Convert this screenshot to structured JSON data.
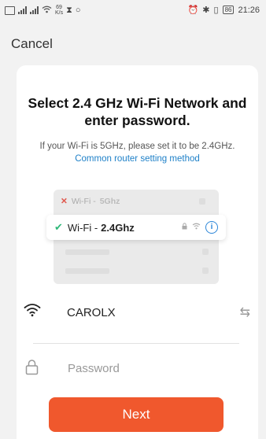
{
  "status_bar": {
    "network_speed_value": "69",
    "network_speed_unit": "K/s",
    "battery_level": "86",
    "time": "21:26"
  },
  "header": {
    "cancel_label": "Cancel"
  },
  "card": {
    "title": "Select 2.4 GHz Wi-Fi Network and enter password.",
    "subtitle_text": "If your Wi-Fi is 5GHz, please set it to be 2.4GHz.",
    "subtitle_link": "Common router setting method"
  },
  "illustration": {
    "row_5g_prefix": "Wi-Fi - ",
    "row_5g_band": "5Ghz",
    "row_24g_prefix": "Wi-Fi - ",
    "row_24g_band": "2.4Ghz"
  },
  "form": {
    "ssid": "CAROLX",
    "password_placeholder": "Password",
    "password_value": ""
  },
  "next_label": "Next",
  "colors": {
    "accent": "#f0582d",
    "link": "#1e80c8",
    "success": "#2fb879",
    "error": "#e05a4f"
  }
}
